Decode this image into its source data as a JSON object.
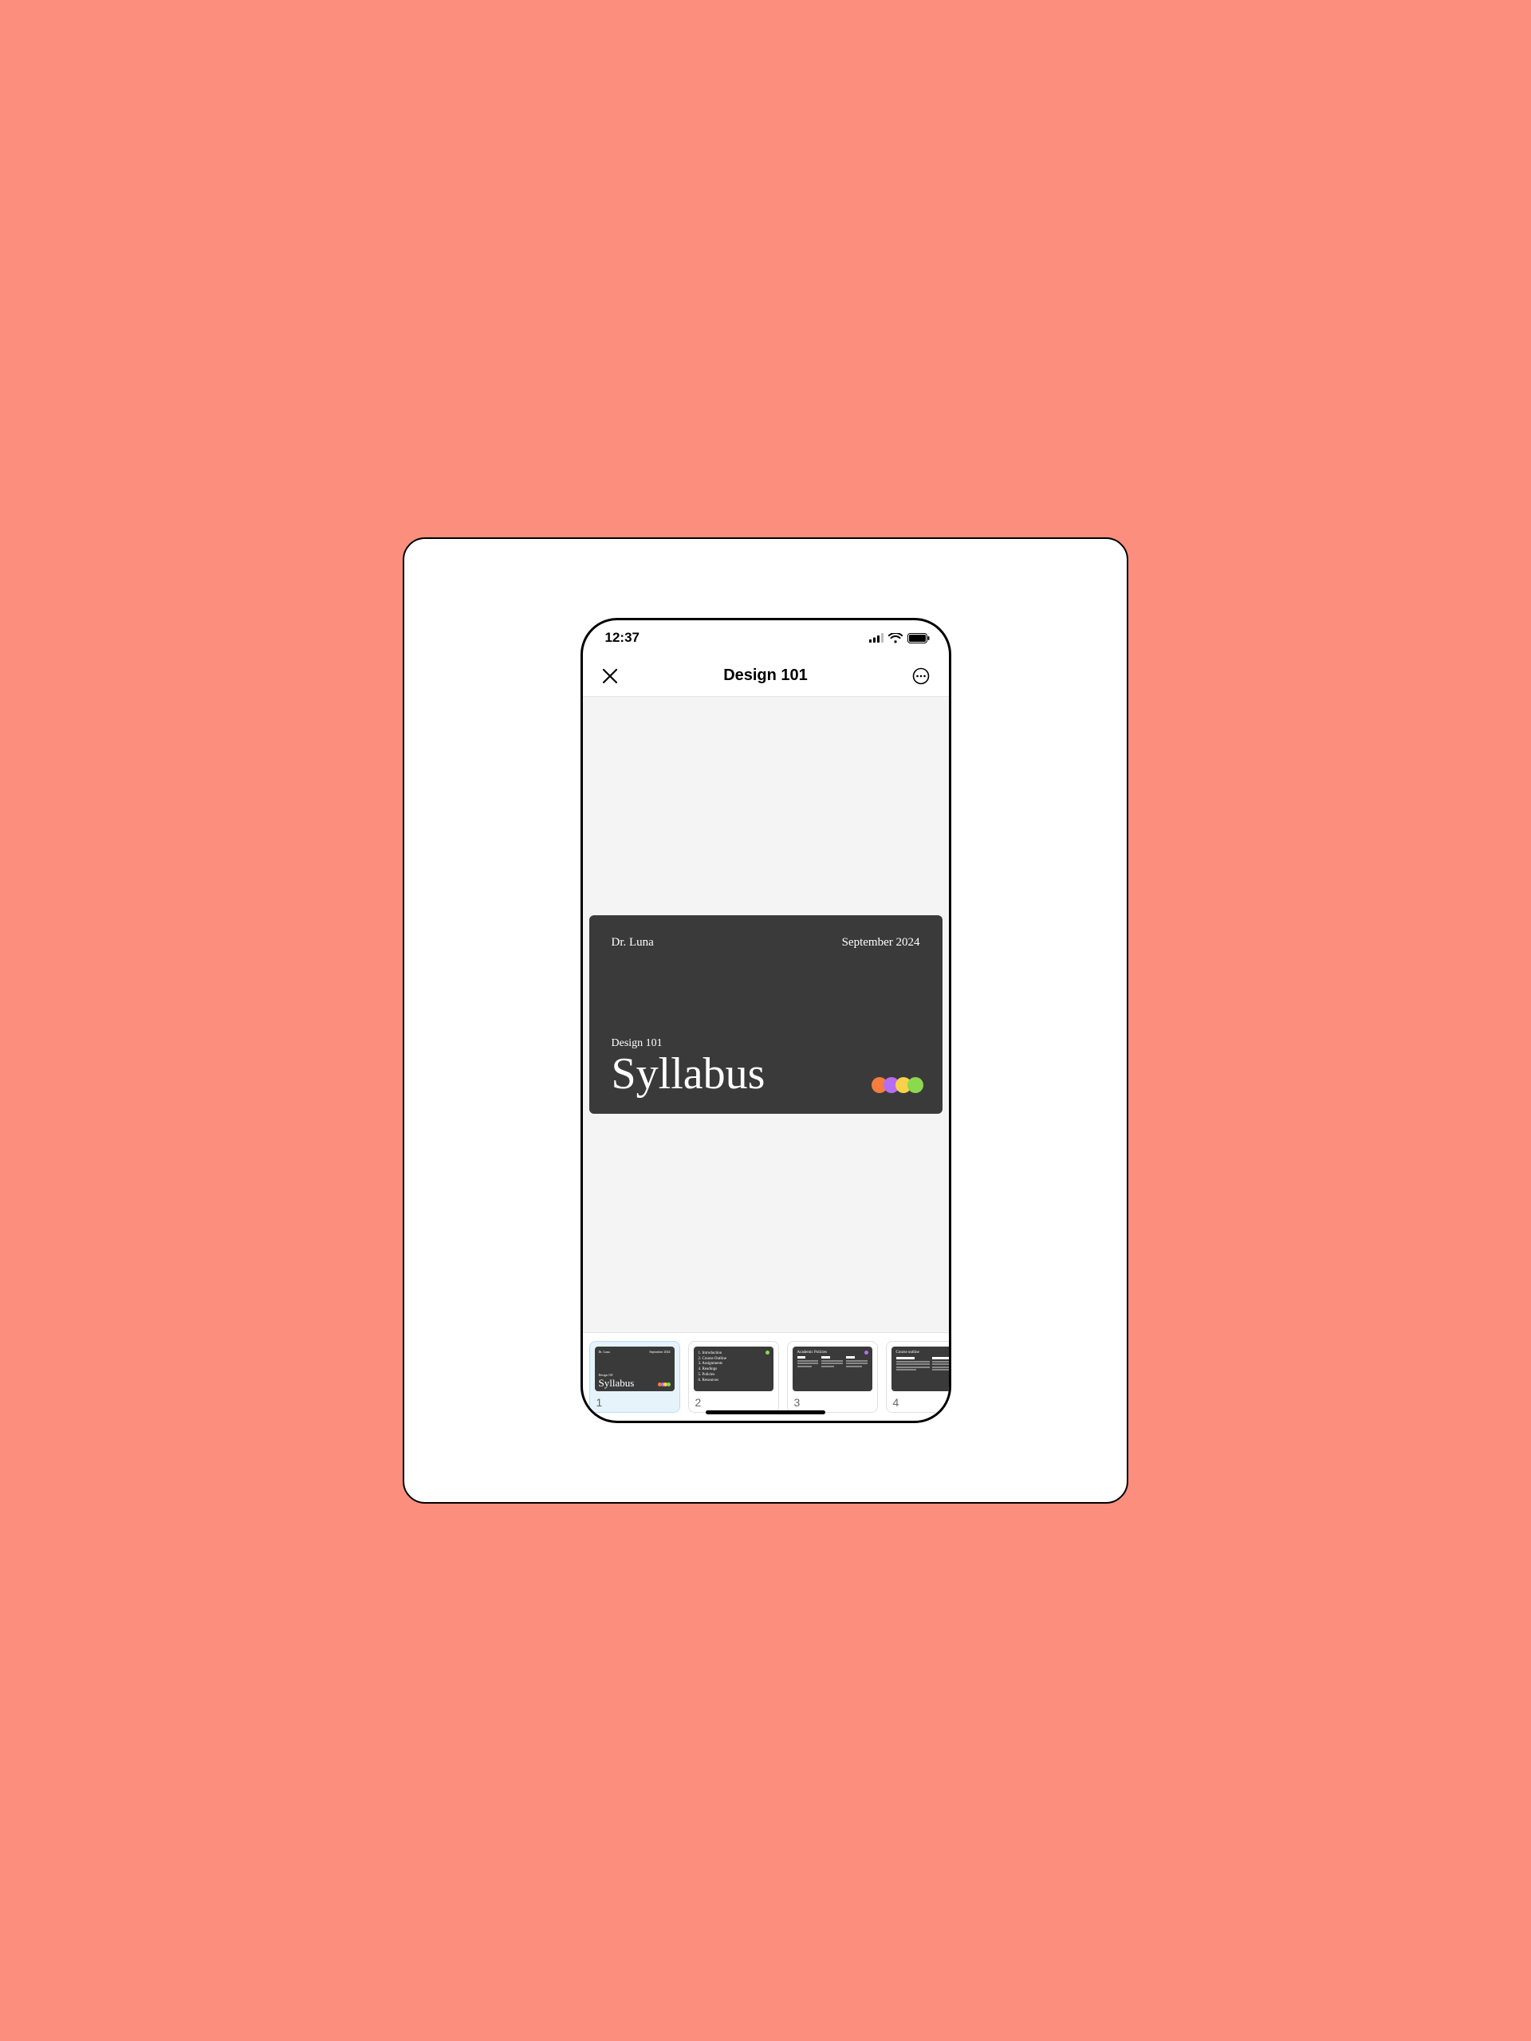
{
  "status": {
    "time": "12:37"
  },
  "nav": {
    "title": "Design 101"
  },
  "slide": {
    "author": "Dr. Luna",
    "date": "September 2024",
    "course": "Design 101",
    "title": "Syllabus"
  },
  "colors": {
    "dot1": "#f57d3f",
    "dot2": "#b76df0",
    "dot3": "#f6d24a",
    "dot4": "#8ad94e",
    "thumb2_dot": "#8ad94e",
    "thumb3_dot": "#b76df0",
    "thumb4_dot": "#b76df0"
  },
  "thumbs": {
    "0": {
      "number": "1",
      "author": "Dr. Luna",
      "date": "September 2024",
      "course": "Design 101",
      "title": "Syllabus"
    },
    "1": {
      "number": "2",
      "lines": {
        "0": "1. Introduction",
        "1": "2. Course Outline",
        "2": "3. Assignments",
        "3": "4. Readings",
        "4": "5. Policies",
        "5": "6. Resources"
      }
    },
    "2": {
      "number": "3",
      "title": "Academic Policies"
    },
    "3": {
      "number": "4",
      "title": "Course outline"
    }
  }
}
